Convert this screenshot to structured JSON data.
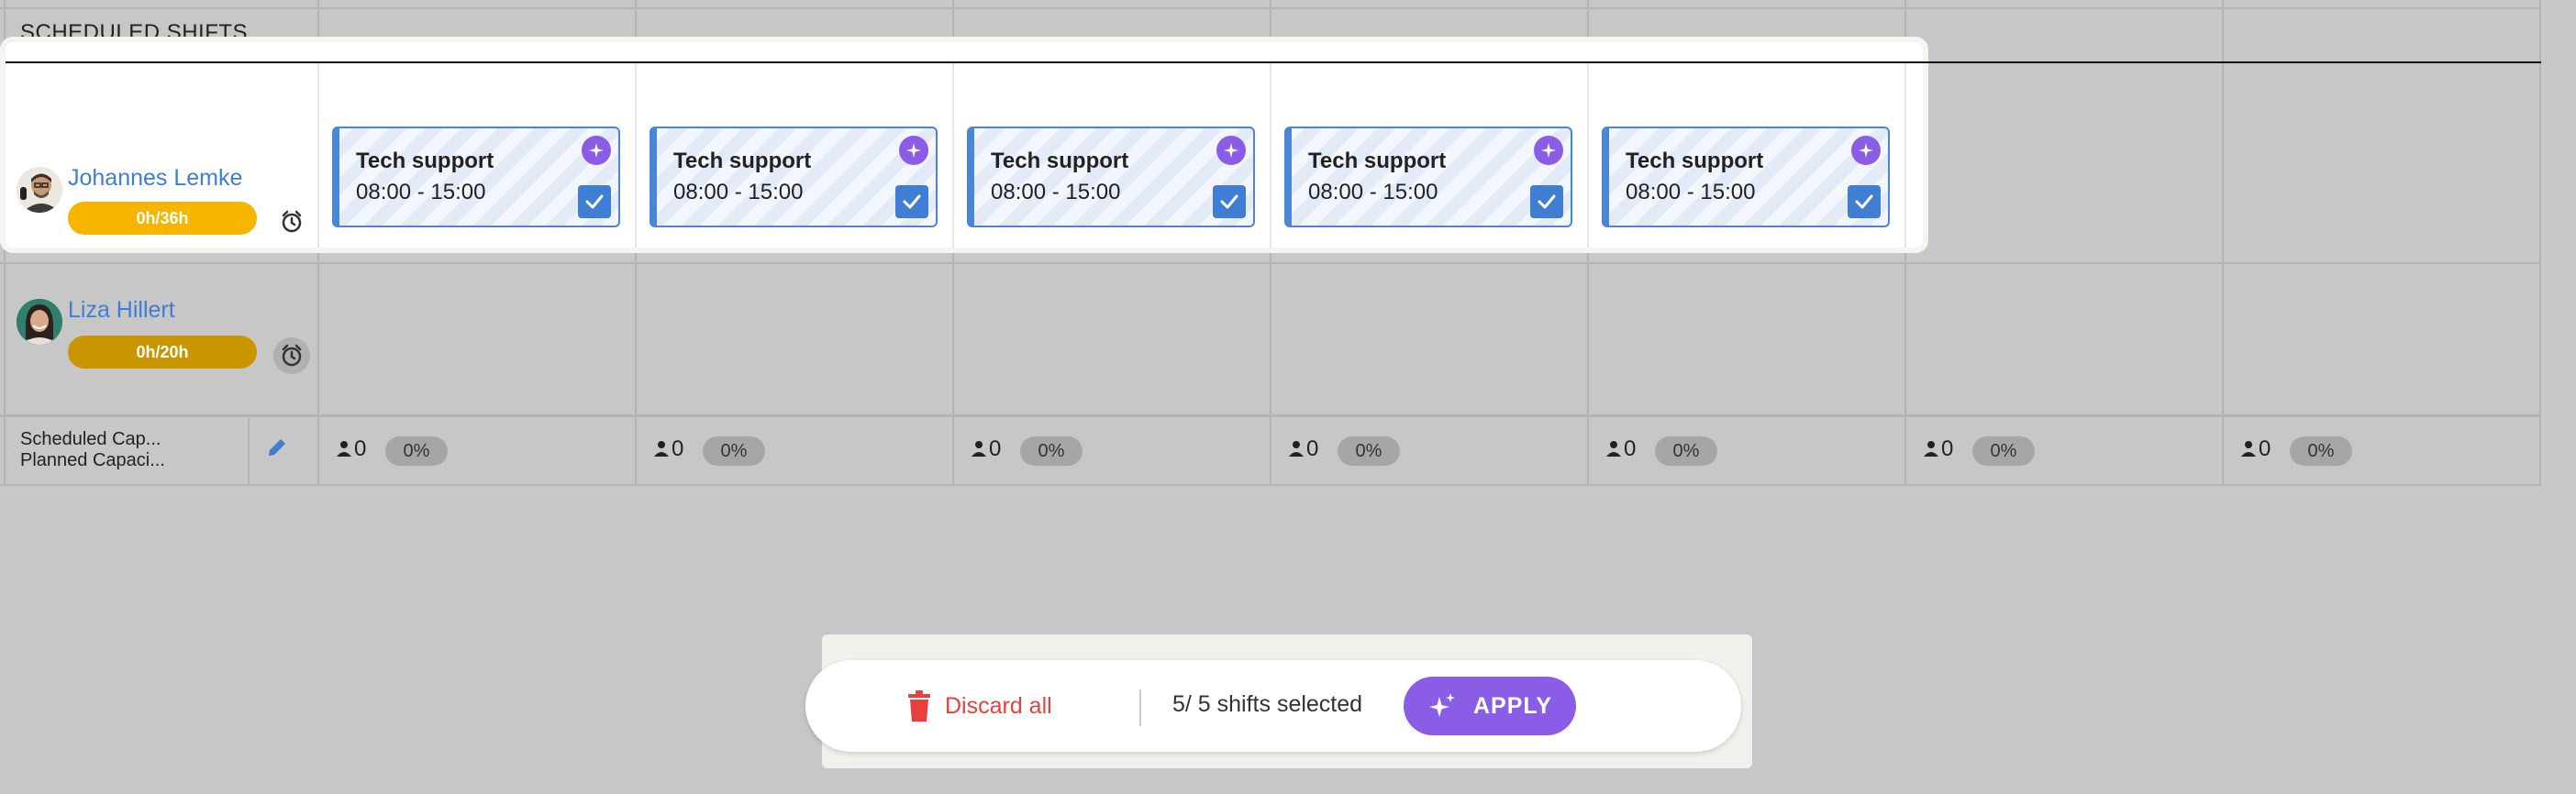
{
  "section": {
    "title": "SCHEDULED SHIFTS"
  },
  "employees": [
    {
      "name": "Johannes Lemke",
      "hours": "0h/36h",
      "hours_color": "#f7b500"
    },
    {
      "name": "Liza Hillert",
      "hours": "0h/20h",
      "hours_color": "#c99600"
    }
  ],
  "shifts": [
    {
      "name": "Tech support",
      "time": "08:00 - 15:00",
      "selected": true
    },
    {
      "name": "Tech support",
      "time": "08:00 - 15:00",
      "selected": true
    },
    {
      "name": "Tech support",
      "time": "08:00 - 15:00",
      "selected": true
    },
    {
      "name": "Tech support",
      "time": "08:00 - 15:00",
      "selected": true
    },
    {
      "name": "Tech support",
      "time": "08:00 - 15:00",
      "selected": true
    }
  ],
  "capacity": {
    "labels": [
      "Scheduled Cap...",
      "Planned Capaci..."
    ],
    "days": [
      {
        "count": "0",
        "percent": "0%"
      },
      {
        "count": "0",
        "percent": "0%"
      },
      {
        "count": "0",
        "percent": "0%"
      },
      {
        "count": "0",
        "percent": "0%"
      },
      {
        "count": "0",
        "percent": "0%"
      },
      {
        "count": "0",
        "percent": "0%"
      },
      {
        "count": "0",
        "percent": "0%"
      }
    ]
  },
  "actionbar": {
    "discard_label": "Discard all",
    "selected_text": "5/ 5 shifts selected",
    "apply_label": "APPLY"
  },
  "colors": {
    "accent": "#8b5ce6",
    "primary": "#3f7ed2",
    "danger": "#e8403f"
  },
  "icons": [
    "person-icon",
    "alarm-clock-icon",
    "sparkle-icon",
    "checkmark-icon",
    "pencil-icon",
    "trash-icon"
  ]
}
